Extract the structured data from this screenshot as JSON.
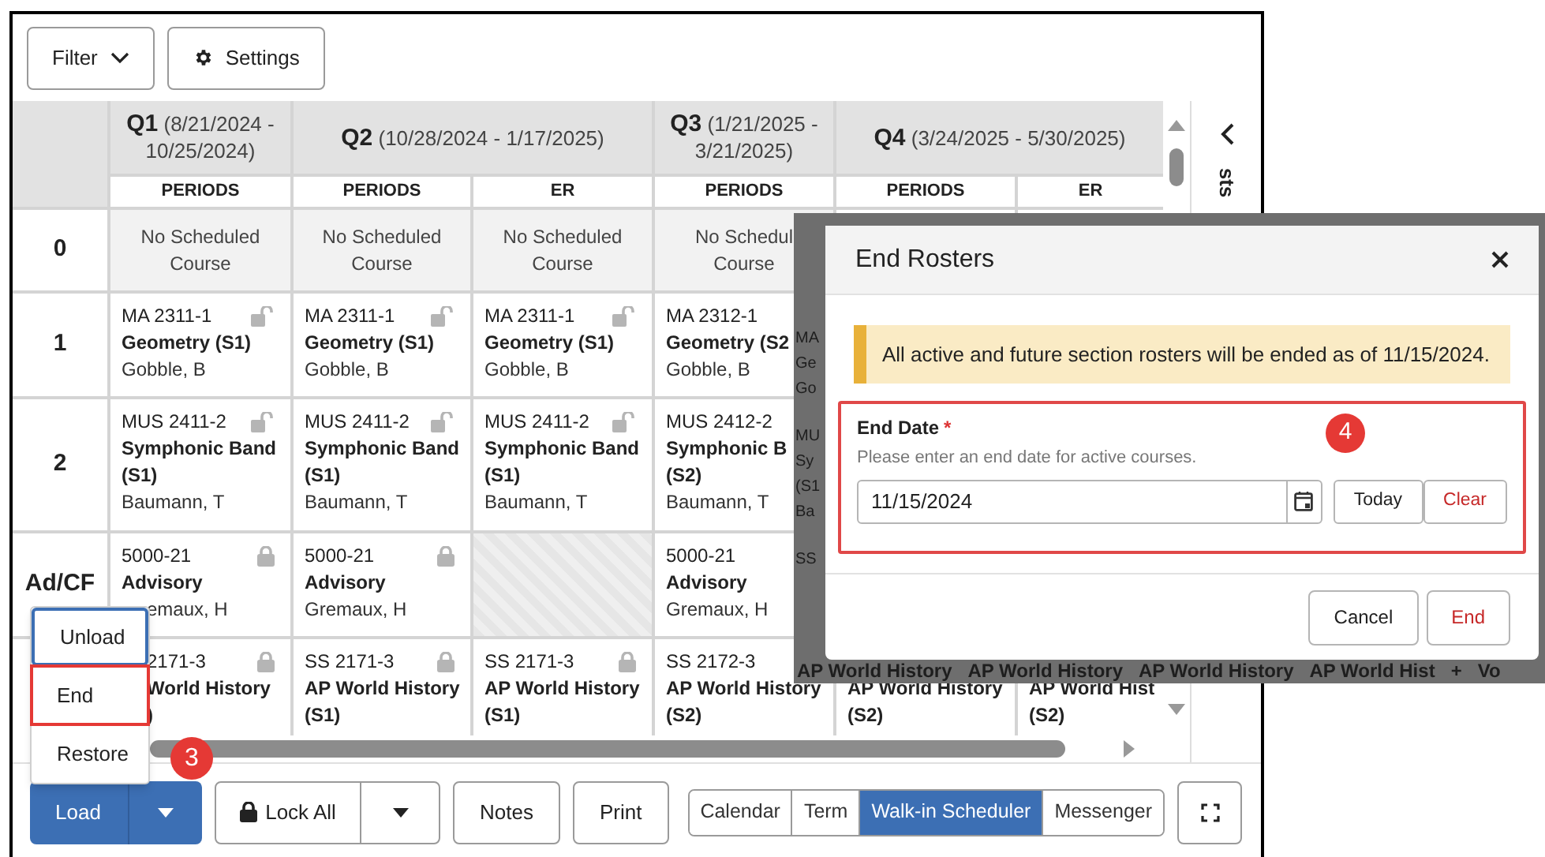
{
  "toolbar": {
    "buttons": [
      {
        "label": "Filter",
        "kind": "dropdown"
      },
      {
        "label": "Settings",
        "kind": "gear"
      }
    ]
  },
  "grid": {
    "terms": [
      {
        "name": "Q1",
        "dates": "(8/21/2024 -",
        "dates_2": "10/25/2024)",
        "columns": [
          "PERIODS"
        ]
      },
      {
        "name": "Q2",
        "dates": "(10/28/2024 - 1/17/2025)",
        "columns": [
          "PERIODS",
          "ER"
        ]
      },
      {
        "name": "Q3",
        "dates": "(1/21/2025 -",
        "dates_2": "3/21/2025)",
        "columns": [
          "PERIODS"
        ]
      },
      {
        "name": "Q4",
        "dates": "(3/24/2025 - 5/30/2025)",
        "columns": [
          "PERIODS",
          "ER"
        ]
      }
    ],
    "rows": [
      {
        "label": "0",
        "cells": [
          {
            "kind": "none",
            "lines": [
              "No Scheduled",
              "Course"
            ]
          },
          {
            "kind": "none",
            "lines": [
              "No Scheduled",
              "Course"
            ]
          },
          {
            "kind": "none",
            "lines": [
              "No Scheduled",
              "Course"
            ]
          },
          {
            "kind": "none",
            "lines": [
              "No Schedul",
              "Course"
            ]
          }
        ]
      },
      {
        "label": "1",
        "cells": [
          {
            "kind": "section",
            "code": "MA 2311-1",
            "course": [
              "Geometry (S1)"
            ],
            "teacher": "Gobble, B",
            "locked": false
          },
          {
            "kind": "section",
            "code": "MA 2311-1",
            "course": [
              "Geometry (S1)"
            ],
            "teacher": "Gobble, B",
            "locked": false
          },
          {
            "kind": "section",
            "code": "MA 2311-1",
            "course": [
              "Geometry (S1)"
            ],
            "teacher": "Gobble, B",
            "locked": false
          },
          {
            "kind": "section",
            "code": "MA 2312-1",
            "course": [
              "Geometry (S2"
            ],
            "teacher": "Gobble, B"
          }
        ]
      },
      {
        "label": "2",
        "cells": [
          {
            "kind": "section",
            "code": "MUS 2411-2",
            "course": [
              "Symphonic Band",
              "(S1)"
            ],
            "teacher": "Baumann, T",
            "locked": false
          },
          {
            "kind": "section",
            "code": "MUS 2411-2",
            "course": [
              "Symphonic Band",
              "(S1)"
            ],
            "teacher": "Baumann, T",
            "locked": false
          },
          {
            "kind": "section",
            "code": "MUS 2411-2",
            "course": [
              "Symphonic Band",
              "(S1)"
            ],
            "teacher": "Baumann, T",
            "locked": false
          },
          {
            "kind": "section",
            "code": "MUS 2412-2",
            "course": [
              "Symphonic B",
              "(S2)"
            ],
            "teacher": "Baumann, T"
          }
        ]
      },
      {
        "label": "Ad/CF",
        "cells": [
          {
            "kind": "section",
            "code": "5000-21",
            "course": [
              "Advisory"
            ],
            "teacher": "emaux, H",
            "locked": true,
            "covered": true
          },
          {
            "kind": "section",
            "code": "5000-21",
            "course": [
              "Advisory"
            ],
            "teacher": "Gremaux, H",
            "locked": true
          },
          {
            "kind": "empty"
          },
          {
            "kind": "section",
            "code": "5000-21",
            "course": [
              "Advisory"
            ],
            "teacher": "Gremaux, H"
          }
        ]
      },
      {
        "cells": [
          {
            "kind": "section",
            "code": "2171-3",
            "course": [
              "World History",
              ")"
            ],
            "locked": true,
            "covered": true
          },
          {
            "kind": "section",
            "code": "SS 2171-3",
            "course": [
              "AP World History",
              "(S1)"
            ],
            "locked": true
          },
          {
            "kind": "section",
            "code": "SS 2171-3",
            "course": [
              "AP World History",
              "(S1)"
            ],
            "locked": true
          },
          {
            "kind": "section",
            "code": "SS 2172-3",
            "course": [
              "AP World History",
              "(S2)"
            ]
          },
          {
            "kind": "section",
            "course": [
              "AP World History",
              "(S2)"
            ]
          },
          {
            "kind": "section",
            "course": [
              "AP World Hist",
              "(S2)"
            ]
          }
        ]
      }
    ]
  },
  "side_panel": {
    "label": "sts"
  },
  "menu": {
    "items": [
      {
        "label": "Unload",
        "focused": true,
        "highlighted": false
      },
      {
        "label": "End",
        "focused": false,
        "highlighted": true
      },
      {
        "label": "Restore",
        "focused": false,
        "highlighted": false
      }
    ],
    "callout": "3"
  },
  "bottom_bar": {
    "load": "Load",
    "lock_all": "Lock All",
    "buttons": [
      "Notes",
      "Print"
    ],
    "views": [
      {
        "label": "Calendar",
        "selected": false
      },
      {
        "label": "Term",
        "selected": false
      },
      {
        "label": "Walk-in Scheduler",
        "selected": true
      },
      {
        "label": "Messenger",
        "selected": false
      }
    ]
  },
  "overlay": {
    "left": [
      "MA",
      "Ge",
      "Go",
      "MU",
      "Sy",
      "(S1",
      "Ba",
      "SS"
    ],
    "bottom": [
      "AP World History",
      "AP World History",
      "AP World History",
      "AP World Hist",
      "+",
      "Vo"
    ],
    "modal": {
      "title": "End Rosters",
      "alert": "All active and future section rosters will be ended as of 11/15/2024.",
      "field": {
        "label": "End Date",
        "required_mark": "*",
        "help": "Please enter an end date for active courses.",
        "value": "11/15/2024",
        "highlighted": true,
        "callout": "4"
      },
      "today": "Today",
      "clear": "Clear",
      "cancel": "Cancel",
      "confirm": "End"
    }
  }
}
